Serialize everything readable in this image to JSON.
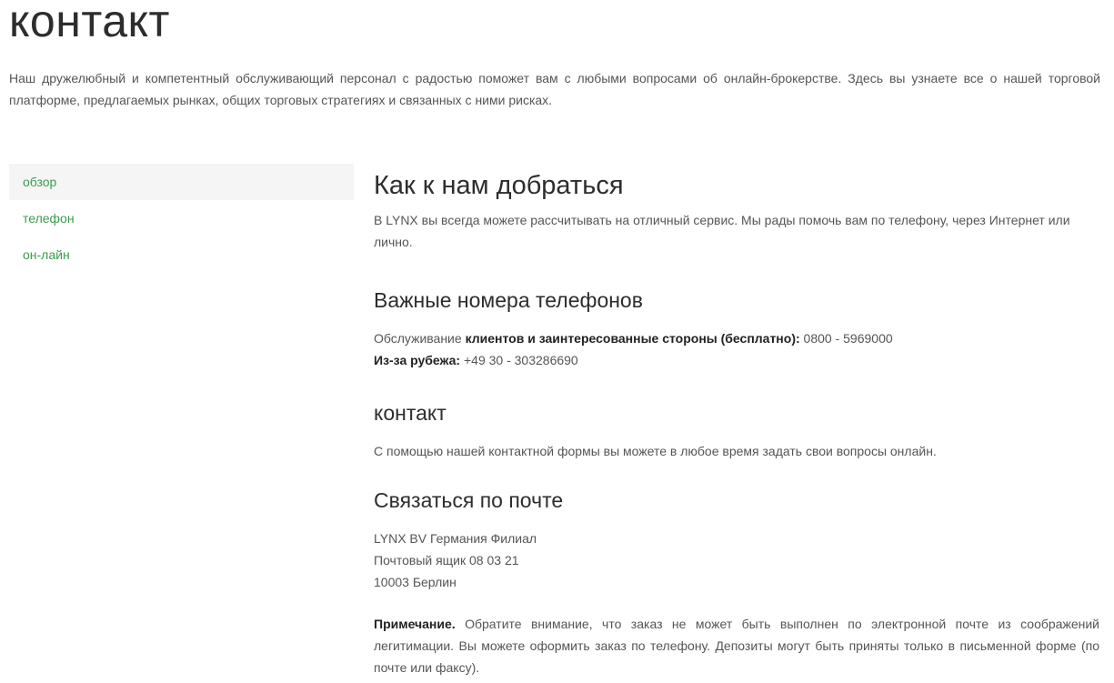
{
  "page": {
    "title": "контакт",
    "intro": "Наш дружелюбный и компетентный обслуживающий персонал с радостью поможет вам с любыми вопросами об онлайн-брокерстве. Здесь вы узнаете все о нашей торговой платформе, предлагаемых рынках, общих торговых стратегиях и связанных с ними рисках."
  },
  "sidebar": {
    "items": [
      {
        "label": "обзор",
        "active": true
      },
      {
        "label": "телефон",
        "active": false
      },
      {
        "label": "он-лайн",
        "active": false
      }
    ]
  },
  "main": {
    "heading": "Как к нам добраться",
    "heading_text": "В LYNX вы всегда можете рассчитывать на отличный сервис. Мы рады помочь вам по телефону, через Интернет или лично.",
    "phones": {
      "heading": "Важные номера телефонов",
      "line1_prefix": "Обслуживание ",
      "line1_bold": "клиентов и заинтересованные стороны (бесплатно):",
      "line1_value": " 0800 - 5969000",
      "line2_bold": "Из-за рубежа:",
      "line2_value": " +49 30 - 303286690"
    },
    "contact": {
      "heading": "контакт",
      "text": "С помощью нашей контактной формы вы можете в любое время задать свои вопросы онлайн."
    },
    "mail": {
      "heading": "Связаться по почте",
      "address_line1": "LYNX BV Германия Филиал",
      "address_line2": "Почтовый ящик 08 03 21",
      "address_line3": "10003 Берлин",
      "note_label": "Примечание.",
      "note_text": " Обратите внимание, что заказ не может быть выполнен по электронной почте из соображений легитимации. Вы можете оформить заказ по телефону. Депозиты могут быть приняты только в письменной форме (по почте или факсу)."
    }
  },
  "colors": {
    "link": "#3a9d4e",
    "active_bg": "#f5f5f5",
    "heading": "#2d2d2d",
    "body_text": "#555555"
  }
}
